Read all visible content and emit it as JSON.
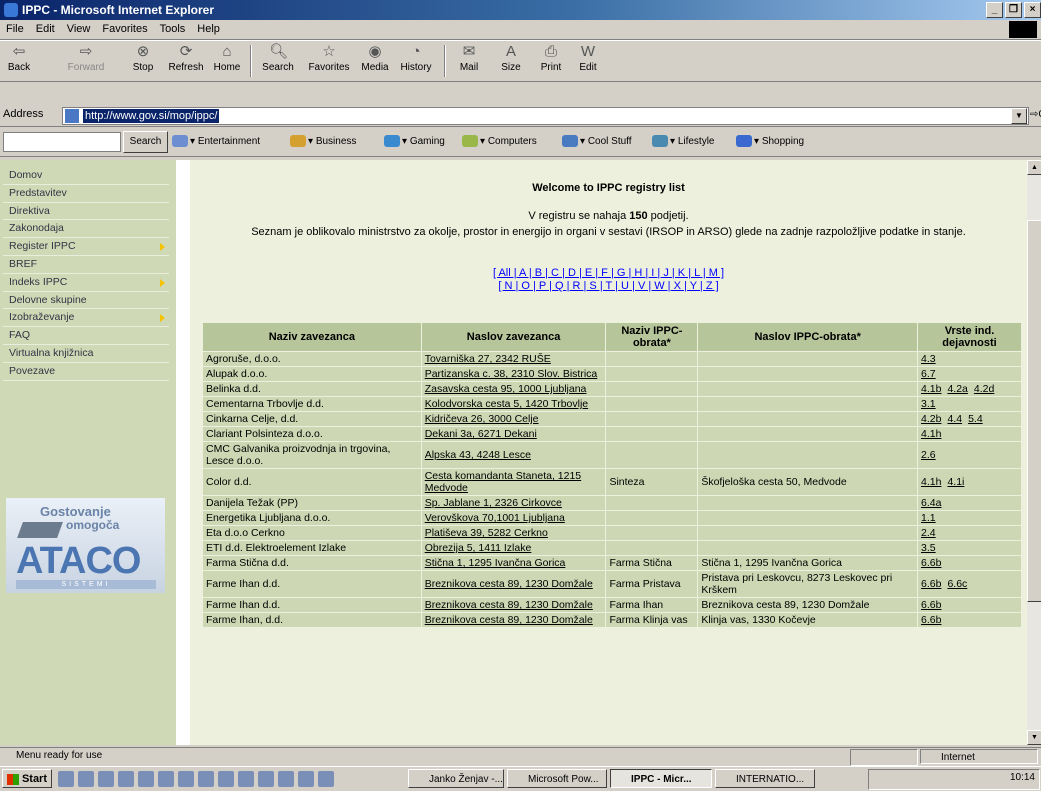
{
  "window": {
    "title": "IPPC - Microsoft Internet Explorer"
  },
  "menu": [
    "File",
    "Edit",
    "View",
    "Favorites",
    "Tools",
    "Help"
  ],
  "toolbar": {
    "back": "Back",
    "forward": "Forward",
    "stop": "Stop",
    "refresh": "Refresh",
    "home": "Home",
    "search": "Search",
    "favorites": "Favorites",
    "media": "Media",
    "history": "History",
    "mail": "Mail",
    "size": "Size",
    "print": "Print",
    "edit": "Edit"
  },
  "address": {
    "label": "Address",
    "url": "http://www.gov.si/mop/ippc/",
    "go": "Go"
  },
  "searchbar": {
    "button": "Search",
    "channels": [
      "Entertainment",
      "Business",
      "Gaming",
      "Computers",
      "Cool Stuff",
      "Lifestyle",
      "Shopping"
    ]
  },
  "sidebar": {
    "items": [
      "Domov",
      "Predstavitev",
      "Direktiva",
      "Zakonodaja",
      "Register IPPC",
      "BREF",
      "Indeks IPPC",
      "Delovne skupine",
      "Izobraževanje",
      "FAQ",
      "Virtualna knjižnica",
      "Povezave"
    ],
    "logo": {
      "line1": "Gostovanje",
      "line2": "omogoča",
      "brand": "ATACO",
      "sub": "SISTEMI"
    }
  },
  "main": {
    "welcome": "Welcome to IPPC registry list",
    "count_pre": "V registru se nahaja ",
    "count_num": "150",
    "count_post": " podjetij.",
    "desc": "Seznam je oblikovalo ministrstvo za okolje, prostor in energijo in organi v sestavi (IRSOP in ARSO) glede na zadnje razpoložljive podatke in stanje.",
    "alpha1": "[ All | A | B | C | D | E | F | G | H | I | J | K | L | M ]",
    "alpha2": "[ N | O | P | Q | R | S | T | U | V | W | X | Y | Z ]"
  },
  "table": {
    "headers": [
      "Naziv zavezanca",
      "Naslov zavezanca",
      "Naziv IPPC-obrata*",
      "Naslov IPPC-obrata*",
      "Vrste ind. dejavnosti"
    ],
    "rows": [
      {
        "name": "Agroruše, d.o.o.",
        "address": "Tovarniška 27, 2342 RUŠE",
        "plant": "",
        "plant_address": "",
        "codes": "4.3"
      },
      {
        "name": "Alupak d.o.o.",
        "address": "Partizanska c. 38, 2310 Slov. Bistrica",
        "plant": "",
        "plant_address": "",
        "codes": "6.7"
      },
      {
        "name": "Belinka d.d.",
        "address": "Zasavska cesta 95, 1000 Ljubljana",
        "plant": "",
        "plant_address": "",
        "codes": "4.1b 4.2a 4.2d"
      },
      {
        "name": "Cementarna Trbovlje d.d.",
        "address": "Kolodvorska cesta 5, 1420 Trbovlje",
        "plant": "",
        "plant_address": "",
        "codes": "3.1"
      },
      {
        "name": "Cinkarna Celje, d.d.",
        "address": "Kidričeva 26, 3000 Celje",
        "plant": "",
        "plant_address": "",
        "codes": "4.2b 4.4 5.4"
      },
      {
        "name": "Clariant Polsinteza d.o.o.",
        "address": "Dekani 3a, 6271 Dekani",
        "plant": "",
        "plant_address": "",
        "codes": "4.1h"
      },
      {
        "name": "CMC Galvanika proizvodnja in trgovina, Lesce d.o.o.",
        "address": "Alpska 43, 4248 Lesce",
        "plant": "",
        "plant_address": "",
        "codes": "2.6"
      },
      {
        "name": "Color d.d.",
        "address": "Cesta komandanta Staneta, 1215 Medvode",
        "plant": "Sinteza",
        "plant_address": "Škofjeloška cesta 50, Medvode",
        "codes": "4.1h 4.1i"
      },
      {
        "name": "Danijela Težak (PP)",
        "address": "Sp. Jablane 1, 2326 Cirkovce",
        "plant": "",
        "plant_address": "",
        "codes": "6.4a"
      },
      {
        "name": "Energetika Ljubljana d.o.o.",
        "address": "Verovškova 70,1001 Ljubljana",
        "plant": "",
        "plant_address": "",
        "codes": "1.1"
      },
      {
        "name": "Eta d.o.o Cerkno",
        "address": "Platiševa 39, 5282 Cerkno",
        "plant": "",
        "plant_address": "",
        "codes": "2.4"
      },
      {
        "name": "ETI d.d. Elektroelement Izlake",
        "address": "Obrezija 5, 1411 Izlake",
        "plant": "",
        "plant_address": "",
        "codes": "3.5"
      },
      {
        "name": "Farma Stična d.d.",
        "address": "Stična 1, 1295 Ivančna Gorica",
        "plant": "Farma Stična",
        "plant_address": "Stična 1, 1295 Ivančna Gorica",
        "codes": "6.6b"
      },
      {
        "name": "Farme Ihan d.d.",
        "address": "Breznikova cesta 89, 1230 Domžale",
        "plant": "Farma Pristava",
        "plant_address": "Pristava pri Leskovcu, 8273 Leskovec pri Krškem",
        "codes": "6.6b 6.6c"
      },
      {
        "name": "Farme Ihan d.d.",
        "address": "Breznikova cesta 89, 1230 Domžale",
        "plant": "Farma Ihan",
        "plant_address": "Breznikova cesta 89, 1230 Domžale",
        "codes": "6.6b"
      },
      {
        "name": "Farme Ihan, d.d.",
        "address": "Breznikova cesta 89, 1230 Domžale",
        "plant": "Farma Klinja vas",
        "plant_address": "Klinja vas, 1330 Kočevje",
        "codes": "6.6b"
      }
    ]
  },
  "status": {
    "message": "Menu ready for use",
    "zone": "Internet"
  },
  "taskbar": {
    "start": "Start",
    "tasks": [
      "Janko Ženjav -...",
      "Microsoft Pow...",
      "IPPC - Micr...",
      "INTERNATIO..."
    ],
    "clock": "10:14"
  }
}
